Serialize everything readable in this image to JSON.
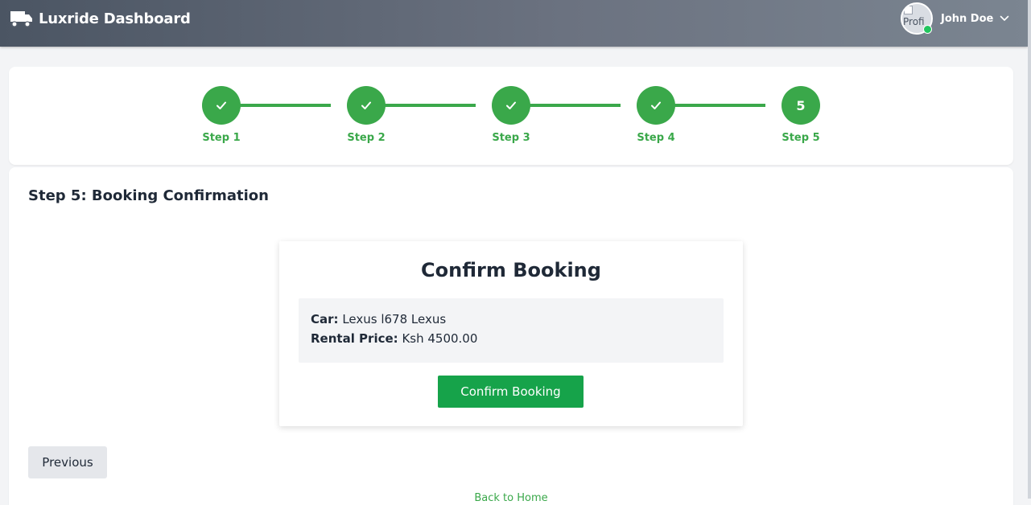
{
  "header": {
    "brand_icon": "truck-icon",
    "brand_title": "Luxride Dashboard",
    "avatar_alt": "Profi",
    "user_name": "John Doe",
    "status_color": "#22c55e"
  },
  "stepper": {
    "active_color": "#3aa84a",
    "steps": [
      {
        "label": "Step 1",
        "state": "complete",
        "icon": "check-icon"
      },
      {
        "label": "Step 2",
        "state": "complete",
        "icon": "check-icon"
      },
      {
        "label": "Step 3",
        "state": "complete",
        "icon": "check-icon"
      },
      {
        "label": "Step 4",
        "state": "complete",
        "icon": "check-icon"
      },
      {
        "label": "Step 5",
        "state": "current",
        "number": "5"
      }
    ]
  },
  "main": {
    "title": "Step 5: Booking Confirmation",
    "confirm": {
      "title": "Confirm Booking",
      "car_label": "Car:",
      "car_value": "Lexus l678 Lexus",
      "price_label": "Rental Price:",
      "price_value": "Ksh 4500.00",
      "button_label": "Confirm Booking",
      "button_color": "#16a34a"
    },
    "previous_label": "Previous",
    "back_link": "Back to Home"
  }
}
